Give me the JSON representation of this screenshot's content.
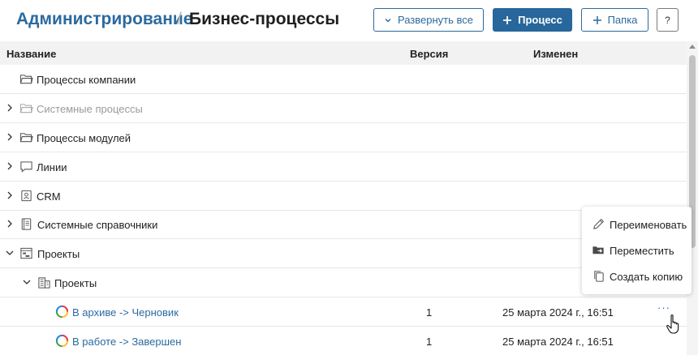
{
  "breadcrumb": {
    "parent": "Администрирование",
    "separator": "/",
    "current": "Бизнес-процессы"
  },
  "toolbar": {
    "expand_all": "Развернуть все",
    "add_process": "Процесс",
    "add_folder": "Папка",
    "help": "?"
  },
  "table": {
    "columns": {
      "name": "Название",
      "version": "Версия",
      "modified": "Изменен"
    },
    "rows": [
      {
        "label": "Процессы компании",
        "expanded": false,
        "muted": false,
        "icon": "folder-icon"
      },
      {
        "label": "Системные процессы",
        "expanded": false,
        "muted": true,
        "icon": "folder-icon"
      },
      {
        "label": "Процессы модулей",
        "expanded": false,
        "muted": false,
        "icon": "folder-icon"
      },
      {
        "label": "Линии",
        "expanded": false,
        "muted": false,
        "icon": "chat-icon"
      },
      {
        "label": "CRM",
        "expanded": false,
        "muted": false,
        "icon": "contact-card-icon"
      },
      {
        "label": "Системные справочники",
        "expanded": false,
        "muted": false,
        "icon": "directory-icon"
      },
      {
        "label": "Проекты",
        "expanded": true,
        "muted": false,
        "icon": "project-board-icon"
      },
      {
        "label": "Проекты",
        "expanded": true,
        "muted": false,
        "icon": "building-icon"
      },
      {
        "label": "В архиве -> Черновик",
        "version": "1",
        "modified": "25 марта 2024 г., 16:51",
        "actions": "···",
        "icon": "process-status-icon"
      },
      {
        "label": "В работе -> Завершен",
        "version": "1",
        "modified": "25 марта 2024 г., 16:51",
        "actions": "···",
        "icon": "process-status-icon"
      }
    ]
  },
  "context_menu": {
    "rename": "Переименовать",
    "move": "Переместить",
    "copy": "Создать копию"
  },
  "colors": {
    "accent": "#2b6a9e",
    "primary_button": "#27679b",
    "header_bg": "#f2f2f2"
  }
}
